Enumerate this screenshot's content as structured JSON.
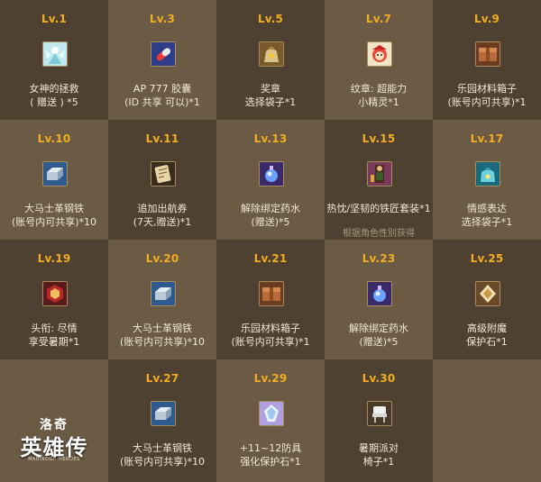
{
  "rewards": [
    {
      "level": "Lv.1",
      "line1": "女神的拯救",
      "line2": "( 赠送 ) *5",
      "icon": "goddess-icon"
    },
    {
      "level": "Lv.3",
      "line1": "AP 777 胶囊",
      "line2": "(ID 共享 可以)*1",
      "icon": "capsule-icon"
    },
    {
      "level": "Lv.5",
      "line1": "奖章",
      "line2": "选择袋子*1",
      "icon": "medal-bag-icon"
    },
    {
      "level": "Lv.7",
      "line1": "纹章: 超能力",
      "line2": "小精灵*1",
      "icon": "sprite-emblem-icon"
    },
    {
      "level": "Lv.9",
      "line1": "乐园材料箱子",
      "line2": "(账号内可共享)*1",
      "icon": "material-box-icon"
    },
    {
      "level": "Lv.10",
      "line1": "大马士革钢铁",
      "line2": "(账号内可共享)*10",
      "icon": "steel-ingot-icon"
    },
    {
      "level": "Lv.11",
      "line1": "追加出航券",
      "line2": "(7天,赠送)*1",
      "icon": "voyage-ticket-icon"
    },
    {
      "level": "Lv.13",
      "line1": "解除绑定药水",
      "line2": "(赠送)*5",
      "icon": "unbind-potion-icon"
    },
    {
      "level": "Lv.15",
      "line1": "热忱/坚韧的铁匠套装*1",
      "line2": "",
      "line3": "根据角色性别获得",
      "icon": "blacksmith-set-icon"
    },
    {
      "level": "Lv.17",
      "line1": "情感表达",
      "line2": "选择袋子*1",
      "icon": "emotion-bag-icon"
    },
    {
      "level": "Lv.19",
      "line1": "头衔: 尽情",
      "line2": "享受暑期*1",
      "icon": "title-icon"
    },
    {
      "level": "Lv.20",
      "line1": "大马士革钢铁",
      "line2": "(账号内可共享)*10",
      "icon": "steel-ingot-icon"
    },
    {
      "level": "Lv.21",
      "line1": "乐园材料箱子",
      "line2": "(账号内可共享)*1",
      "icon": "material-box-icon"
    },
    {
      "level": "Lv.23",
      "line1": "解除绑定药水",
      "line2": "(赠送)*5",
      "icon": "unbind-potion-icon"
    },
    {
      "level": "Lv.25",
      "line1": "高级附魔",
      "line2": "保护石*1",
      "icon": "enchant-stone-icon"
    },
    {
      "level": "Lv.27",
      "line1": "大马士革钢铁",
      "line2": "(账号内可共享)*10",
      "icon": "steel-ingot-icon"
    },
    {
      "level": "Lv.29",
      "line1": "+11~12防具",
      "line2": "强化保护石*1",
      "icon": "armor-stone-icon"
    },
    {
      "level": "Lv.30",
      "line1": "暑期派对",
      "line2": "椅子*1",
      "icon": "party-chair-icon"
    }
  ],
  "logo": {
    "line1": "洛奇",
    "line2": "英雄传",
    "line3": "MABINOGI: HEROES"
  },
  "colors": {
    "level": "#f2ad22",
    "text": "#f1e7d6",
    "note": "#a8987e",
    "cell_light": "#6b5a44",
    "cell_dark": "#4e4131"
  }
}
